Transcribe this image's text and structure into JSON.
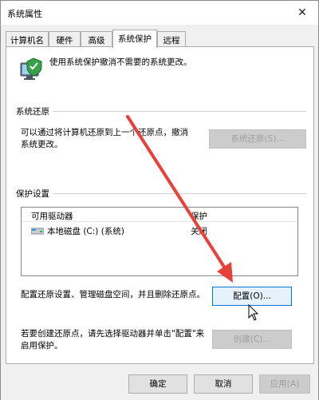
{
  "window": {
    "title": "系统属性",
    "close_glyph": "✕"
  },
  "tabs": [
    {
      "label": "计算机名",
      "active": false
    },
    {
      "label": "硬件",
      "active": false
    },
    {
      "label": "高级",
      "active": false
    },
    {
      "label": "系统保护",
      "active": true
    },
    {
      "label": "远程",
      "active": false
    }
  ],
  "intro": {
    "text": "使用系统保护撤消不需要的系统更改。"
  },
  "restore": {
    "group_label": "系统还原",
    "description_line1": "可以通过将计算机还原到上一个还原点，撤消",
    "description_line2": "系统更改。",
    "button_label": "系统还原(S)..."
  },
  "protection": {
    "group_label": "保护设置",
    "columns": [
      "可用驱动器",
      "保护"
    ],
    "rows": [
      {
        "drive": "本地磁盘 (C:) (系统)",
        "status": "关闭"
      }
    ],
    "configure_text": "配置还原设置、管理磁盘空间，并且删除还原点。",
    "configure_button": "配置(O)...",
    "create_text_line1": "若要创建还原点，请先选择驱动器并单击\"配置\"来",
    "create_text_line2": "启用保护。",
    "create_button": "创建(C)..."
  },
  "footer": {
    "ok_label": "确定",
    "cancel_label": "取消",
    "apply_label": "应用(A)"
  },
  "colors": {
    "annotation_arrow": "#e8403a",
    "focus_border": "#0078d7"
  }
}
